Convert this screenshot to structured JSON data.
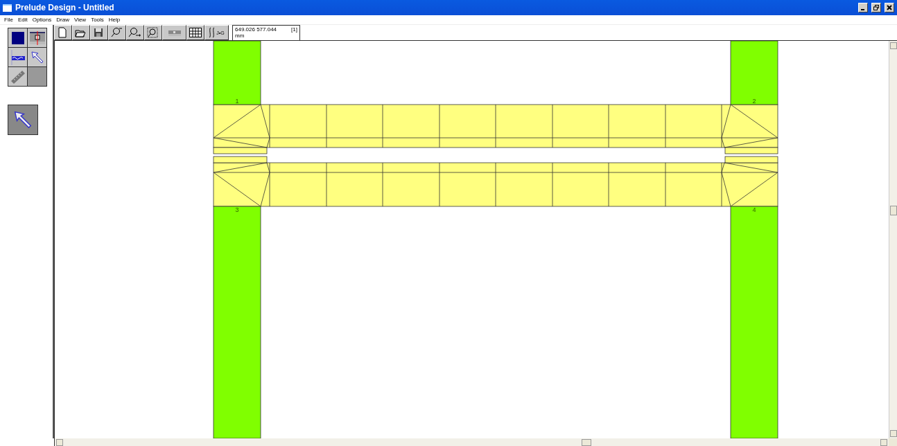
{
  "window": {
    "title": "Prelude Design - Untitled"
  },
  "menu": [
    "File",
    "Edit",
    "Options",
    "Draw",
    "View",
    "Tools",
    "Help"
  ],
  "toolbar": [
    {
      "kind": "new"
    },
    {
      "kind": "open"
    },
    {
      "kind": "save"
    },
    {
      "kind": "zoom-in"
    },
    {
      "kind": "zoom-pan"
    },
    {
      "kind": "zoom-fit"
    },
    {
      "kind": "section"
    },
    {
      "kind": "grid"
    },
    {
      "kind": "integral",
      "label": "J•G"
    }
  ],
  "status": {
    "coordinates": "649.026  577.044 mm",
    "layer": "[1]"
  },
  "palette": [
    {
      "kind": "swatch"
    },
    {
      "kind": "member"
    },
    {
      "kind": "load"
    },
    {
      "kind": "pointer"
    },
    {
      "kind": "ruler"
    },
    {
      "kind": "empty"
    }
  ],
  "columns": [
    {
      "label": "1"
    },
    {
      "label": "2"
    },
    {
      "label": "3"
    },
    {
      "label": "4"
    }
  ]
}
